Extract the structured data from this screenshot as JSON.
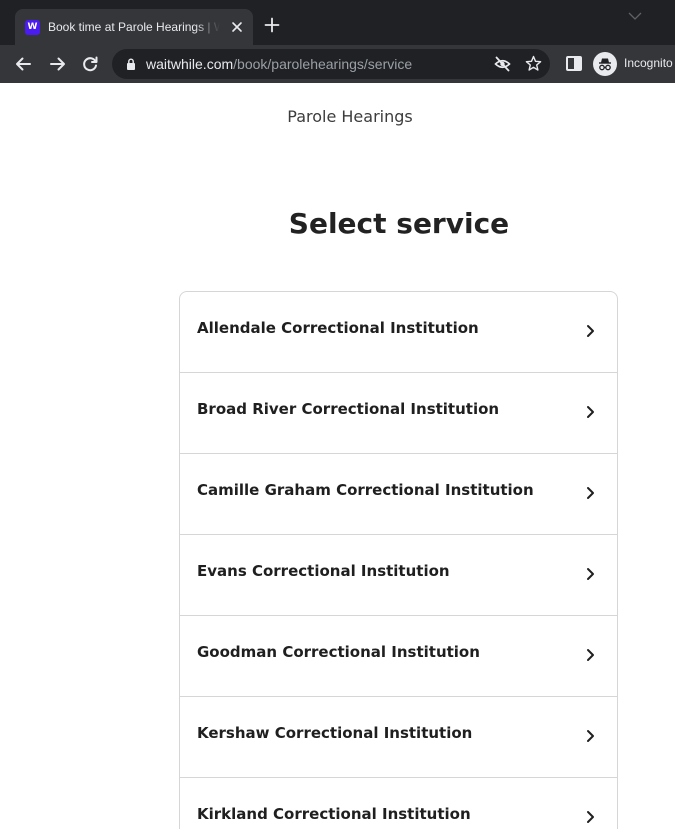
{
  "browser": {
    "tab": {
      "title": "Book time at Parole Hearings | Waitwhile",
      "favicon_letter": "W",
      "favicon_color": "#4b1cf2"
    },
    "omnibox": {
      "url_host": "waitwhile.com",
      "url_path": "/book/parolehearings/service"
    },
    "profile_label": "Incognito"
  },
  "page": {
    "org_name": "Parole Hearings",
    "heading": "Select service",
    "services": [
      {
        "name": "Allendale Correctional Institution"
      },
      {
        "name": "Broad River Correctional Institution"
      },
      {
        "name": "Camille Graham Correctional Institution"
      },
      {
        "name": "Evans Correctional Institution"
      },
      {
        "name": "Goodman Correctional Institution"
      },
      {
        "name": "Kershaw Correctional Institution"
      },
      {
        "name": "Kirkland Correctional Institution"
      }
    ]
  },
  "colors": {
    "chrome_dark": "#202124",
    "chrome_toolbar": "#35363a",
    "list_border": "#d6d6d6",
    "text_primary": "#1f1f1f"
  },
  "icons": {
    "tab_close": "close-icon",
    "new_tab": "plus-icon",
    "back": "arrow-left-icon",
    "forward": "arrow-right-icon",
    "reload": "reload-icon",
    "lock": "lock-icon",
    "tracking": "eye-off-icon",
    "bookmark": "star-icon",
    "side_panel": "side-panel-icon",
    "incognito": "incognito-icon",
    "row_arrow": "chevron-right-icon"
  }
}
